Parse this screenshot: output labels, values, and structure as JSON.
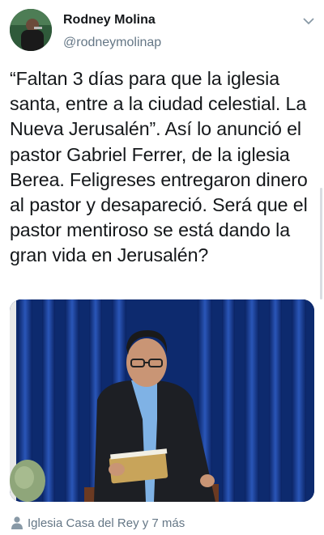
{
  "tweet": {
    "author_name": "Rodney Molina",
    "author_handle": "@rodneymolinap",
    "text": "“Faltan 3 días para que la iglesia santa, entre a la ciudad celestial. La Nueva Jerusalén”. Así lo anunció el pastor Gabriel Ferrer, de la iglesia Berea. Feligreses entregaron dinero al pastor y desapareció. Será que el pastor mentiroso se está dando la gran vida en Jerusalén?",
    "tagged": "Iglesia Casa del Rey y 7 más"
  },
  "icons": {
    "menu": "chevron-down-icon",
    "tag": "person-icon"
  },
  "colors": {
    "secondary_text": "#657786",
    "curtain": "#0d2a6e"
  }
}
